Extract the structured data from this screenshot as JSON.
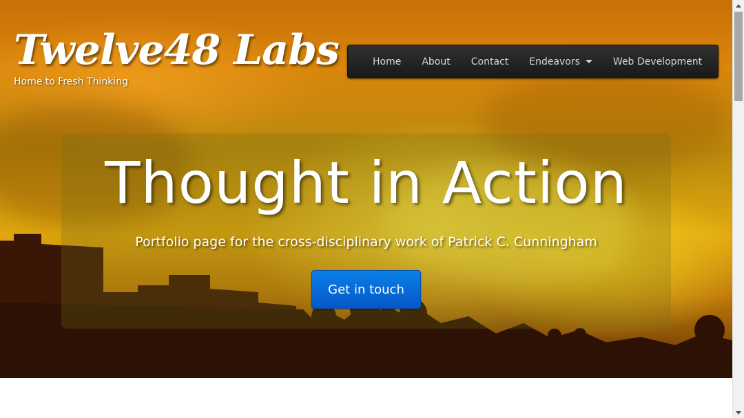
{
  "site": {
    "logo_text": "Twelve48 Labs",
    "tagline": "Home to Fresh Thinking"
  },
  "nav": {
    "items": [
      {
        "label": "Home"
      },
      {
        "label": "About"
      },
      {
        "label": "Contact"
      },
      {
        "label": "Endeavors",
        "has_dropdown": true,
        "icon": "caret-down-icon"
      },
      {
        "label": "Web Development"
      }
    ]
  },
  "hero": {
    "headline": "Thought in Action",
    "subheading": "Portfolio page for the cross-disciplinary work of Patrick C. Cunningham",
    "cta_label": "Get in touch"
  },
  "colors": {
    "nav_background": "#222222",
    "nav_text": "#d6d6d6",
    "cta_blue": "#0a6ed8",
    "sky_orange": "#d9860c",
    "sky_yellow": "#e8b612"
  }
}
